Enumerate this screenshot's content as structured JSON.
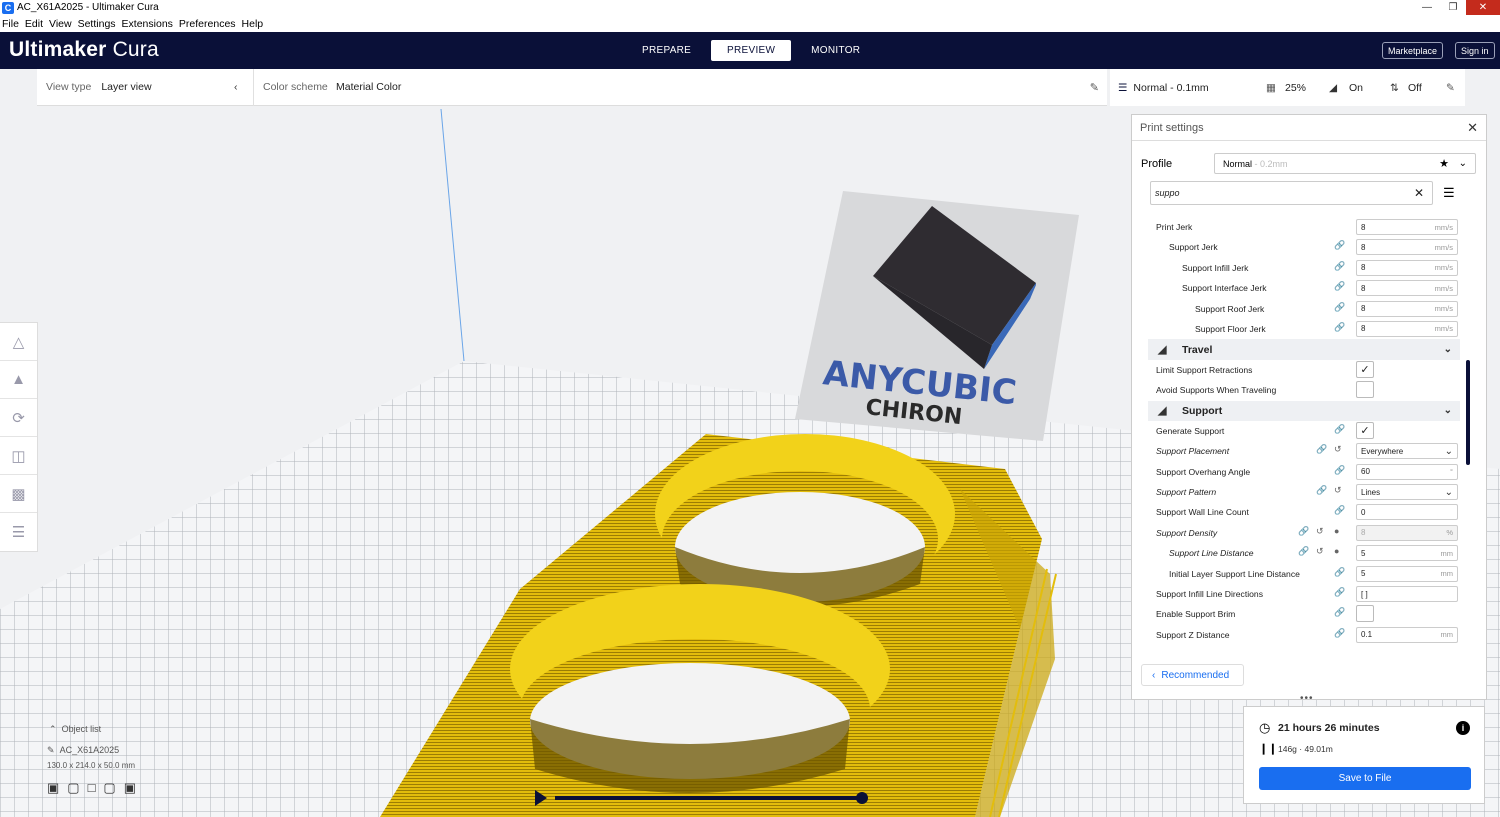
{
  "window": {
    "title": "AC_X61A2025 - Ultimaker Cura",
    "app_icon": "C"
  },
  "menu": [
    "File",
    "Edit",
    "View",
    "Settings",
    "Extensions",
    "Preferences",
    "Help"
  ],
  "header": {
    "brand_bold": "Ultimaker",
    "brand_light": "Cura",
    "stages": [
      "PREPARE",
      "PREVIEW",
      "MONITOR"
    ],
    "marketplace": "Marketplace",
    "signin": "Sign in"
  },
  "viewbar": {
    "view_type_label": "View type",
    "view_type_value": "Layer view",
    "color_scheme_label": "Color scheme",
    "color_scheme_value": "Material Color"
  },
  "printbar": {
    "profile": "Normal - 0.1mm",
    "infill": "25%",
    "support": "On",
    "adhesion": "Off"
  },
  "bed_logo": {
    "brand": "ANYCUBIC",
    "model": "CHIRON"
  },
  "object": {
    "list_label": "Object list",
    "name": "AC_X61A2025",
    "dims": "130.0 x 214.0 x 50.0 mm"
  },
  "print_settings": {
    "title": "Print settings",
    "profile_label": "Profile",
    "profile_value": "Normal",
    "profile_sub": "- 0.2mm",
    "search_value": "suppo",
    "rows": [
      {
        "kind": "field",
        "name": "Print Jerk",
        "indent": 0,
        "value": "8",
        "unit": "mm/s",
        "icons": ""
      },
      {
        "kind": "field",
        "name": "Support Jerk",
        "indent": 1,
        "value": "8",
        "unit": "mm/s",
        "icons": "link"
      },
      {
        "kind": "field",
        "name": "Support Infill Jerk",
        "indent": 2,
        "value": "8",
        "unit": "mm/s",
        "icons": "link"
      },
      {
        "kind": "field",
        "name": "Support Interface Jerk",
        "indent": 2,
        "value": "8",
        "unit": "mm/s",
        "icons": "link"
      },
      {
        "kind": "field",
        "name": "Support Roof Jerk",
        "indent": 3,
        "value": "8",
        "unit": "mm/s",
        "icons": "link"
      },
      {
        "kind": "field",
        "name": "Support Floor Jerk",
        "indent": 3,
        "value": "8",
        "unit": "mm/s",
        "icons": "link"
      },
      {
        "kind": "category",
        "name": "Travel"
      },
      {
        "kind": "check",
        "name": "Limit Support Retractions",
        "indent": 0,
        "checked": true,
        "icons": ""
      },
      {
        "kind": "check",
        "name": "Avoid Supports When Traveling",
        "indent": 0,
        "checked": false,
        "icons": ""
      },
      {
        "kind": "category",
        "name": "Support"
      },
      {
        "kind": "check",
        "name": "Generate Support",
        "indent": 0,
        "checked": true,
        "icons": "link"
      },
      {
        "kind": "select",
        "name": "Support Placement",
        "indent": 0,
        "value": "Everywhere",
        "italic": true,
        "icons": "link reset"
      },
      {
        "kind": "field",
        "name": "Support Overhang Angle",
        "indent": 0,
        "value": "60",
        "unit": "°",
        "icons": "link"
      },
      {
        "kind": "select",
        "name": "Support Pattern",
        "indent": 0,
        "value": "Lines",
        "italic": true,
        "icons": "link reset"
      },
      {
        "kind": "field",
        "name": "Support Wall Line Count",
        "indent": 0,
        "value": "0",
        "unit": "",
        "icons": "link"
      },
      {
        "kind": "field",
        "name": "Support Density",
        "indent": 0,
        "value": "8",
        "unit": "%",
        "italic": true,
        "disabled": true,
        "icons": "link reset fx"
      },
      {
        "kind": "field",
        "name": "Support Line Distance",
        "indent": 1,
        "value": "5",
        "unit": "mm",
        "italic": true,
        "icons": "link reset fx"
      },
      {
        "kind": "field",
        "name": "Initial Layer Support Line Distance",
        "indent": 1,
        "value": "5",
        "unit": "mm",
        "icons": "link"
      },
      {
        "kind": "field",
        "name": "Support Infill Line Directions",
        "indent": 0,
        "value": "[ ]",
        "unit": "",
        "icons": "link"
      },
      {
        "kind": "check",
        "name": "Enable Support Brim",
        "indent": 0,
        "checked": false,
        "icons": "link"
      },
      {
        "kind": "field",
        "name": "Support Z Distance",
        "indent": 0,
        "value": "0.1",
        "unit": "mm",
        "icons": "link"
      }
    ],
    "recommended": "Recommended"
  },
  "estimate": {
    "time": "21 hours 26 minutes",
    "material": "146g · 49.01m",
    "save": "Save to File"
  },
  "colors": {
    "header": "#0a1038",
    "accent": "#196ef0",
    "model": "#e8c20a"
  }
}
